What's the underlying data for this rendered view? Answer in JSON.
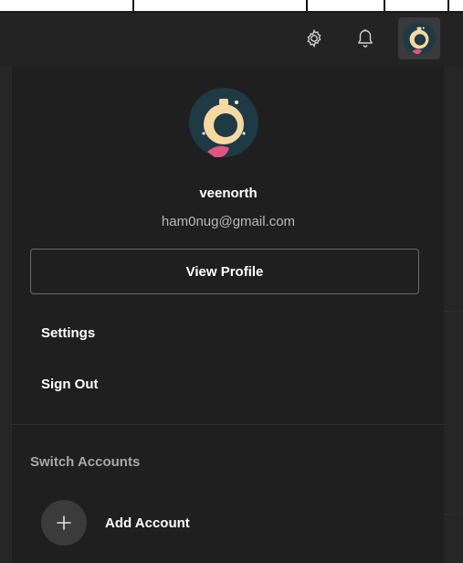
{
  "header": {
    "settings_icon": "gear-icon",
    "notifications_icon": "bell-icon",
    "avatar_icon": "astronaut-avatar"
  },
  "profile": {
    "username": "veenorth",
    "email": "ham0nug@gmail.com",
    "view_profile_label": "View Profile"
  },
  "menu": {
    "items": [
      {
        "label": "Settings"
      },
      {
        "label": "Sign Out"
      }
    ]
  },
  "switch_accounts": {
    "title": "Switch Accounts",
    "add_account_label": "Add Account",
    "add_icon": "plus-icon"
  },
  "colors": {
    "panel_bg": "#1f1f1f",
    "topbar_bg": "#232323",
    "text_primary": "#ffffff",
    "text_secondary": "#b8b8b8",
    "avatar_bg": "#1e3a45",
    "avatar_accent": "#f6d9a0"
  }
}
